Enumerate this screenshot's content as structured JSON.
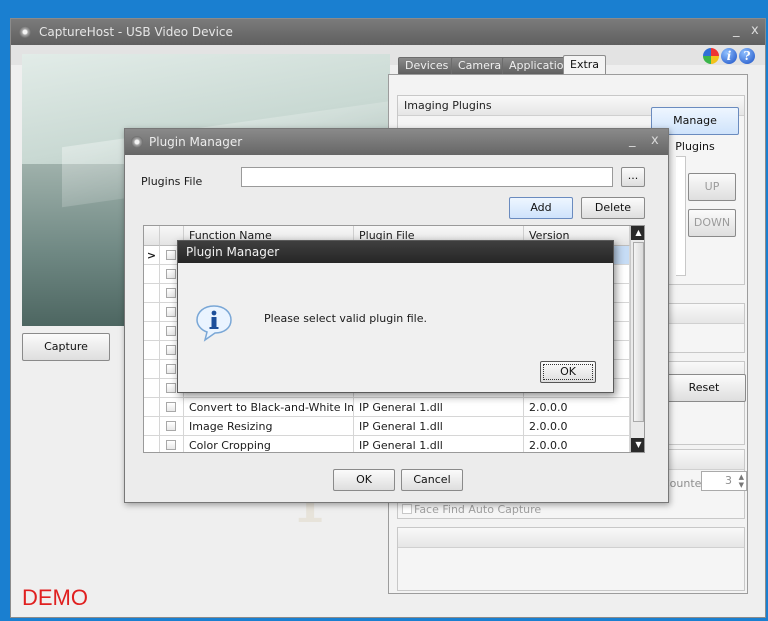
{
  "main_window": {
    "title": "CaptureHost - USB Video Device",
    "minimize": "_",
    "close": "x"
  },
  "help_bar": {
    "icons": [
      "color-wheel-icon",
      "info-icon",
      "help-icon"
    ],
    "info_glyph": "i",
    "help_glyph": "?"
  },
  "left": {
    "capture_label": "Capture",
    "demo_label": "DEMO"
  },
  "tabs": [
    {
      "label": "Devices"
    },
    {
      "label": "Camera"
    },
    {
      "label": "Application"
    },
    {
      "label": "Extra"
    }
  ],
  "extra_tab": {
    "imaging_plugins_title": "Imaging Plugins",
    "manage_plugins_label": "Manage Plugins",
    "up_label": "UP",
    "down_label": "DOWN",
    "reset_label": "Reset",
    "counter_label": "Counter",
    "counter_value": "3",
    "face_find_label": "Face Find Auto Capture"
  },
  "plugin_manager": {
    "title": "Plugin Manager",
    "close": "x",
    "minimize": "_",
    "plugins_file_label": "Plugins File",
    "plugins_file_value": "",
    "browse_label": "...",
    "add_label": "Add",
    "delete_label": "Delete",
    "columns": [
      "Function Name",
      "Plugin File",
      "Version"
    ],
    "rows": [
      {
        "name": "",
        "file": "",
        "version": ""
      },
      {
        "name": "",
        "file": "",
        "version": ""
      },
      {
        "name": "",
        "file": "",
        "version": ""
      },
      {
        "name": "",
        "file": "",
        "version": ""
      },
      {
        "name": "",
        "file": "",
        "version": ""
      },
      {
        "name": "",
        "file": "",
        "version": ""
      },
      {
        "name": "",
        "file": "",
        "version": ""
      },
      {
        "name": "",
        "file": "",
        "version": ""
      },
      {
        "name": "Convert to Black-and-White Image",
        "file": "IP General 1.dll",
        "version": "2.0.0.0"
      },
      {
        "name": "Image Resizing",
        "file": "IP General 1.dll",
        "version": "2.0.0.0"
      },
      {
        "name": "Color Cropping",
        "file": "IP General 1.dll",
        "version": "2.0.0.0"
      }
    ],
    "current_row_indicator": ">",
    "ok_label": "OK",
    "cancel_label": "Cancel"
  },
  "message_box": {
    "title": "Plugin Manager",
    "message": "Please select valid plugin file.",
    "ok_label": "OK",
    "icon": "information-icon"
  }
}
